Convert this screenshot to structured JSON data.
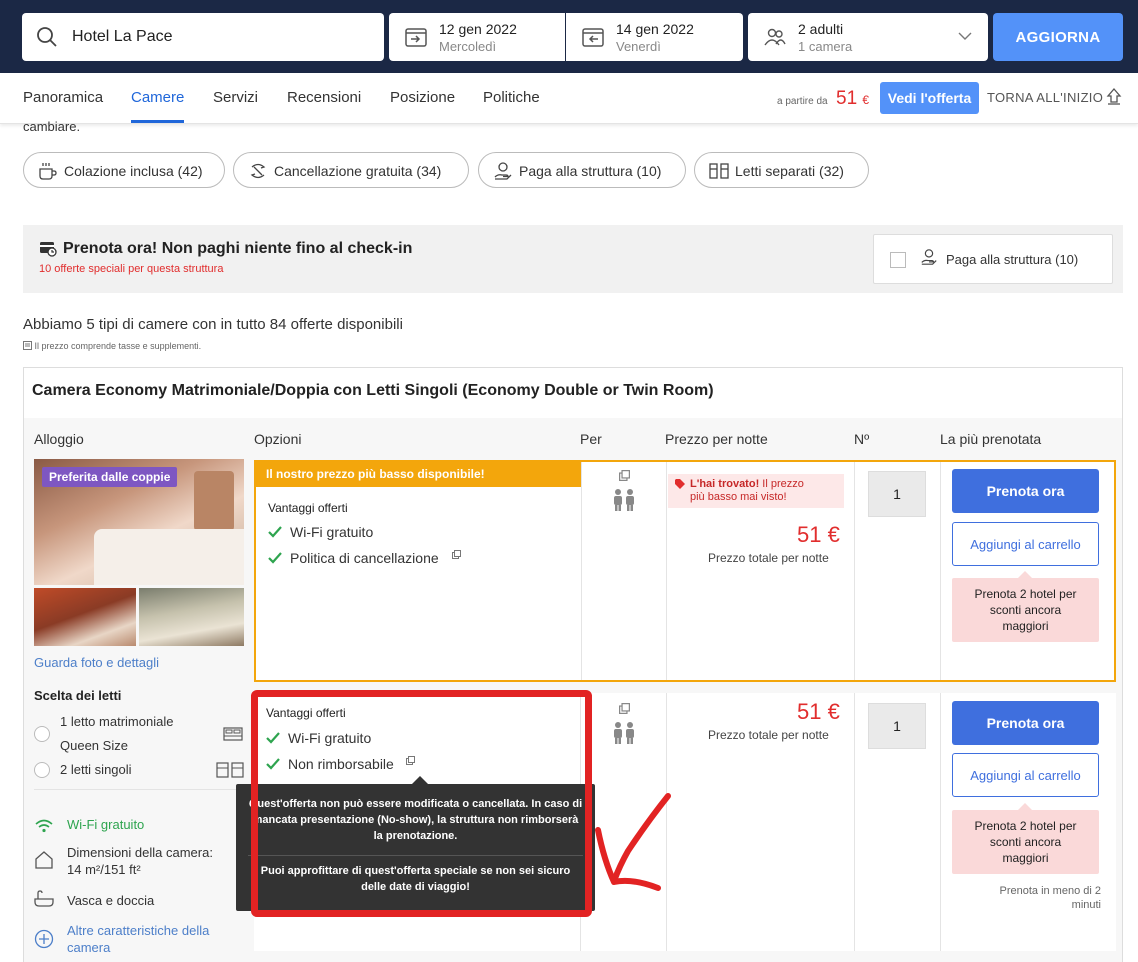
{
  "search": {
    "value": "Hotel La Pace"
  },
  "checkin": {
    "date": "12 gen 2022",
    "day": "Mercoledì"
  },
  "checkout": {
    "date": "14 gen 2022",
    "day": "Venerdì"
  },
  "guests": {
    "adults": "2 adulti",
    "rooms": "1 camera"
  },
  "update_label": "AGGIORNA",
  "nav": {
    "tabs": [
      "Panoramica",
      "Camere",
      "Servizi",
      "Recensioni",
      "Posizione",
      "Politiche"
    ],
    "active_tab": "Camere",
    "from_label": "a partire da",
    "price": "51",
    "currency": "€",
    "offer_button": "Vedi l'offerta",
    "back_top": "TORNA ALL'INIZIO"
  },
  "cut_text": "cambiare.",
  "filters": [
    "Colazione inclusa (42)",
    "Cancellazione gratuita (34)",
    "Paga alla struttura (10)",
    "Letti separati (32)"
  ],
  "book_now": {
    "title": "Prenota ora! Non paghi niente fino al check-in",
    "subtitle": "10 offerte speciali per questa struttura",
    "pay_filter": "Paga alla struttura (10)"
  },
  "rooms_summary": "Abbiamo 5 tipi di camere con in tutto 84 offerte disponibili",
  "price_note": "Il prezzo comprende tasse e supplementi.",
  "room": {
    "title": "Camera Economy Matrimoniale/Doppia con Letti Singoli (Economy Double or Twin Room)",
    "columns": [
      "Alloggio",
      "Opzioni",
      "Per",
      "Prezzo per notte",
      "Nº",
      "La più prenotata"
    ],
    "badge": "Preferita dalle coppie",
    "photo_link": "Guarda foto e dettagli",
    "beds_heading": "Scelta dei letti",
    "bed_options": [
      "1 letto matrimoniale",
      "Queen Size",
      "2 letti singoli"
    ],
    "features": [
      "Wi-Fi gratuito",
      "Dimensioni della camera:",
      "14 m²/151 ft²",
      "Vasca e doccia",
      "Altre caratteristiche della",
      "camera"
    ],
    "colors": {
      "accent": "#2067da",
      "price": "#e12d2d",
      "highlight": "#f3a60c",
      "wifi": "#2ea44f"
    }
  },
  "offers": [
    {
      "banner": "Il nostro prezzo più basso disponibile!",
      "benefits_heading": "Vantaggi offerti",
      "benefits": [
        "Wi-Fi gratuito",
        "Politica di cancellazione"
      ],
      "found_bold": "L'hai trovato!",
      "found_rest": " Il prezzo",
      "found_line2": "più basso mai visto!",
      "price": "51 €",
      "price_label": "Prezzo totale per notte",
      "qty": "1",
      "book": "Prenota ora",
      "cart": "Aggiungi al carrello",
      "promo": [
        "Prenota 2 hotel per",
        "sconti ancora",
        "maggiori"
      ]
    },
    {
      "benefits_heading": "Vantaggi offerti",
      "benefits": [
        "Wi-Fi gratuito",
        "Non rimborsabile"
      ],
      "price": "51 €",
      "price_label": "Prezzo totale per notte",
      "qty": "1",
      "book": "Prenota ora",
      "cart": "Aggiungi al carrello",
      "promo": [
        "Prenota 2 hotel per",
        "sconti ancora",
        "maggiori"
      ],
      "recent": [
        "Prenota in meno di 2",
        "minuti"
      ]
    }
  ],
  "tooltip": {
    "p1": "Quest'offerta non può essere modificata o cancellata. In caso di mancata presentazione (No-show), la struttura non rimborserà la prenotazione.",
    "p2": "Puoi approfittare di quest'offerta speciale se non sei sicuro delle date di viaggio!"
  }
}
